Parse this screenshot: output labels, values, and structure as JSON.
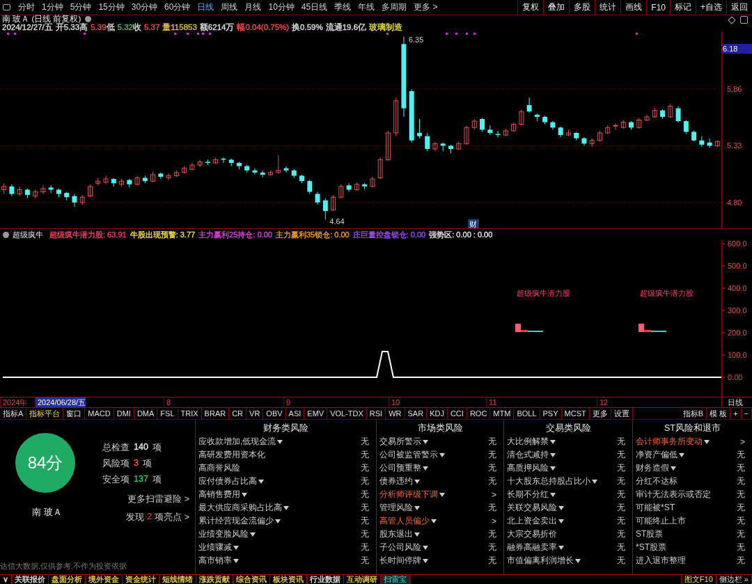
{
  "period_bar": {
    "items": [
      {
        "label": "分时",
        "selected": false
      },
      {
        "label": "1分钟",
        "selected": false
      },
      {
        "label": "5分钟",
        "selected": false
      },
      {
        "label": "15分钟",
        "selected": false
      },
      {
        "label": "30分钟",
        "selected": false
      },
      {
        "label": "60分钟",
        "selected": false
      },
      {
        "label": "日线",
        "selected": true
      },
      {
        "label": "周线",
        "selected": false
      },
      {
        "label": "月线",
        "selected": false
      },
      {
        "label": "10分钟",
        "selected": false
      },
      {
        "label": "45日线",
        "selected": false
      },
      {
        "label": "季线",
        "selected": false
      },
      {
        "label": "年线",
        "selected": false
      },
      {
        "label": "多周期",
        "selected": false
      },
      {
        "label": "更多 >",
        "selected": false
      }
    ],
    "buttons": [
      "复权",
      "叠加",
      "多股",
      "统计",
      "画线",
      "F10",
      "标记",
      "+自选",
      "返回"
    ]
  },
  "stock_header": {
    "title": "南 玻Ａ (日线 前复权)",
    "quote": [
      {
        "text": "2024/12/27/五",
        "color": "#e0e0e0"
      },
      {
        "text": "开5.33",
        "color": "#e0e0e0"
      },
      {
        "text": "高"
      },
      {
        "text": "5.39",
        "color": "#ff4a4a"
      },
      {
        "text": "低"
      },
      {
        "text": "5.32",
        "color": "#3ad13a"
      },
      {
        "text": "收"
      },
      {
        "text": "5.37",
        "color": "#ff4a4a"
      },
      {
        "text": "量115853",
        "color": "#e8c33a"
      },
      {
        "text": "额6214万",
        "color": "#e0e0e0"
      },
      {
        "text": "幅0.04(0.75%)",
        "color": "#ff4a4a"
      },
      {
        "text": "换0.59%",
        "color": "#e0e0e0"
      },
      {
        "text": "流通19.6亿",
        "color": "#e0e0e0"
      },
      {
        "text": "玻璃制造",
        "color": "#e8e03a"
      }
    ]
  },
  "price_chart": {
    "cursor_price": "6.18",
    "high_label": "6.35",
    "low_label": "4.64",
    "event_marker": "财",
    "chart_data": {
      "type": "candlestick",
      "grid": true,
      "ylim": [
        4.559,
        6.36
      ],
      "yticks": [
        {
          "value": 5.86,
          "label": "5.86"
        },
        {
          "value": 5.33,
          "label": "5.33"
        },
        {
          "value": 4.8,
          "label": "4.80"
        }
      ],
      "categories": [
        null,
        null,
        null,
        null,
        null,
        null,
        null,
        null,
        null,
        null,
        null,
        null,
        null,
        null,
        null,
        null,
        null,
        null,
        null,
        null,
        null,
        null,
        null,
        null,
        null,
        null,
        null,
        null,
        null,
        null,
        null,
        null,
        null,
        null,
        null,
        null,
        null,
        null,
        null,
        null,
        null,
        null,
        null,
        null,
        null,
        null,
        null,
        null,
        null,
        null,
        null,
        null,
        null,
        null,
        null,
        null,
        null,
        null,
        null,
        null,
        null,
        null,
        null,
        null,
        null,
        null,
        null,
        null,
        null,
        null,
        null,
        null,
        null,
        null,
        null,
        null,
        null,
        null,
        null,
        null,
        null,
        null,
        null,
        null,
        null,
        null,
        null,
        null,
        null,
        null,
        null,
        null
      ],
      "ohlc": [
        [
          4.92,
          4.98,
          4.88,
          4.95
        ],
        [
          4.95,
          4.97,
          4.86,
          4.88
        ],
        [
          4.88,
          4.95,
          4.86,
          4.92
        ],
        [
          4.92,
          4.93,
          4.84,
          4.87
        ],
        [
          4.86,
          4.92,
          4.84,
          4.9
        ],
        [
          4.9,
          4.96,
          4.88,
          4.93
        ],
        [
          4.94,
          4.96,
          4.89,
          4.92
        ],
        [
          4.92,
          4.93,
          4.85,
          4.88
        ],
        [
          4.89,
          4.9,
          4.82,
          4.85
        ],
        [
          4.86,
          4.88,
          4.76,
          4.8
        ],
        [
          4.8,
          4.87,
          4.78,
          4.85
        ],
        [
          4.86,
          4.97,
          4.85,
          4.95
        ],
        [
          4.98,
          5.03,
          4.96,
          5.0
        ],
        [
          4.99,
          5.05,
          4.97,
          5.02
        ],
        [
          5.02,
          5.03,
          4.95,
          4.98
        ],
        [
          4.97,
          5.02,
          4.95,
          5.0
        ],
        [
          5.01,
          5.02,
          4.94,
          4.97
        ],
        [
          4.97,
          5.05,
          4.96,
          5.03
        ],
        [
          5.03,
          5.05,
          4.98,
          5.0
        ],
        [
          5.0,
          5.09,
          4.99,
          5.06
        ],
        [
          5.07,
          5.08,
          5.02,
          5.04
        ],
        [
          5.03,
          5.07,
          5.01,
          5.05
        ],
        [
          5.05,
          5.1,
          5.04,
          5.08
        ],
        [
          5.08,
          5.14,
          5.07,
          5.12
        ],
        [
          5.11,
          5.17,
          5.1,
          5.15
        ],
        [
          5.15,
          5.2,
          5.13,
          5.18
        ],
        [
          5.18,
          5.2,
          5.15,
          5.17
        ],
        [
          5.17,
          5.22,
          5.16,
          5.2
        ],
        [
          5.21,
          5.22,
          5.17,
          5.2
        ],
        [
          5.2,
          5.21,
          5.14,
          5.17
        ],
        [
          5.17,
          5.18,
          5.11,
          5.14
        ],
        [
          5.14,
          5.15,
          5.08,
          5.1
        ],
        [
          5.1,
          5.12,
          5.06,
          5.08
        ],
        [
          5.08,
          5.1,
          5.04,
          5.06
        ],
        [
          5.06,
          5.1,
          5.05,
          5.08
        ],
        [
          5.08,
          5.24,
          5.07,
          5.1
        ],
        [
          5.12,
          5.14,
          5.08,
          5.1
        ],
        [
          5.1,
          5.11,
          5.03,
          5.05
        ],
        [
          5.05,
          5.06,
          4.98,
          5.0
        ],
        [
          5.0,
          5.01,
          4.88,
          4.9
        ],
        [
          4.88,
          4.9,
          4.78,
          4.8
        ],
        [
          4.82,
          4.84,
          4.64,
          4.72
        ],
        [
          4.73,
          4.87,
          4.72,
          4.85
        ],
        [
          4.85,
          4.97,
          4.84,
          4.95
        ],
        [
          4.96,
          4.98,
          4.9,
          4.92
        ],
        [
          4.92,
          4.99,
          4.91,
          4.97
        ],
        [
          4.97,
          4.98,
          4.92,
          4.95
        ],
        [
          4.95,
          5.04,
          4.94,
          5.02
        ],
        [
          5.03,
          5.22,
          5.02,
          5.2
        ],
        [
          5.2,
          5.47,
          5.19,
          5.45
        ],
        [
          5.45,
          5.78,
          5.42,
          5.75
        ],
        [
          6.28,
          6.35,
          5.6,
          5.68
        ],
        [
          5.84,
          5.86,
          5.36,
          5.38
        ],
        [
          5.45,
          5.58,
          5.4,
          5.42
        ],
        [
          5.42,
          5.45,
          5.28,
          5.3
        ],
        [
          5.3,
          5.37,
          5.28,
          5.35
        ],
        [
          5.35,
          5.36,
          5.28,
          5.33
        ],
        [
          5.33,
          5.34,
          5.26,
          5.3
        ],
        [
          5.3,
          5.37,
          5.29,
          5.35
        ],
        [
          5.35,
          5.52,
          5.34,
          5.5
        ],
        [
          5.5,
          5.58,
          5.48,
          5.56
        ],
        [
          5.58,
          5.59,
          5.46,
          5.48
        ],
        [
          5.48,
          5.52,
          5.43,
          5.45
        ],
        [
          5.44,
          5.47,
          5.41,
          5.43
        ],
        [
          5.43,
          5.49,
          5.42,
          5.47
        ],
        [
          5.47,
          5.55,
          5.46,
          5.53
        ],
        [
          5.53,
          5.67,
          5.52,
          5.65
        ],
        [
          5.71,
          5.78,
          5.64,
          5.65
        ],
        [
          5.62,
          5.63,
          5.56,
          5.6
        ],
        [
          5.6,
          5.61,
          5.53,
          5.55
        ],
        [
          5.55,
          5.56,
          5.48,
          5.5
        ],
        [
          5.5,
          5.51,
          5.41,
          5.43
        ],
        [
          5.43,
          5.48,
          5.42,
          5.45
        ],
        [
          5.45,
          5.46,
          5.38,
          5.4
        ],
        [
          5.4,
          5.41,
          5.33,
          5.35
        ],
        [
          5.35,
          5.4,
          5.32,
          5.38
        ],
        [
          5.38,
          5.47,
          5.37,
          5.45
        ],
        [
          5.45,
          5.52,
          5.44,
          5.5
        ],
        [
          5.52,
          5.54,
          5.48,
          5.52
        ],
        [
          5.5,
          5.57,
          5.49,
          5.55
        ],
        [
          5.55,
          5.56,
          5.48,
          5.5
        ],
        [
          5.5,
          5.59,
          5.49,
          5.57
        ],
        [
          5.57,
          5.62,
          5.56,
          5.6
        ],
        [
          5.6,
          5.68,
          5.59,
          5.66
        ],
        [
          5.66,
          5.67,
          5.58,
          5.6
        ],
        [
          5.6,
          5.72,
          5.59,
          5.7
        ],
        [
          5.68,
          5.7,
          5.55,
          5.56
        ],
        [
          5.56,
          5.57,
          5.44,
          5.46
        ],
        [
          5.46,
          5.47,
          5.37,
          5.38
        ],
        [
          5.38,
          5.42,
          5.32,
          5.34
        ],
        [
          5.36,
          5.4,
          5.31,
          5.33
        ],
        [
          5.33,
          5.38,
          5.32,
          5.37
        ]
      ]
    }
  },
  "indicator": {
    "name": "超级疯牛",
    "values": [
      {
        "text": "超级疯牛潜力股: 63.91",
        "color": "#ff3a6a"
      },
      {
        "text": "牛股出现预警: 3.77",
        "color": "#f0e040"
      },
      {
        "text": "主力赢利25持仓: 0.00",
        "color": "#e040e0"
      },
      {
        "text": "主力赢利35锁仓: 0.00",
        "color": "#f0a020"
      },
      {
        "text": "庄巨量控盘锁仓: 0.00",
        "color": "#9a50ff"
      },
      {
        "text": "强势区: 0.00 : 0.00",
        "color": "#e8e8e8"
      }
    ],
    "signal_labels": [
      "超级疯牛潜力股",
      "超级疯牛潜力股"
    ],
    "axis_labels": [
      "600.0",
      "500.0",
      "400.0",
      "300.0",
      "200.0",
      "100.0",
      "0.00"
    ]
  },
  "timeline": {
    "labels": [
      {
        "text": "2024年",
        "selected": false
      },
      {
        "text": "2024/06/28/五",
        "selected": true
      },
      {
        "text": "8",
        "selected": false
      },
      {
        "text": "9",
        "selected": false
      },
      {
        "text": "10",
        "selected": false
      },
      {
        "text": "11",
        "selected": false
      },
      {
        "text": "12",
        "selected": false
      }
    ],
    "period": "日线"
  },
  "indicator_tabs": {
    "items": [
      {
        "label": "指标A",
        "selected": false
      },
      {
        "label": "指标平台",
        "selected": true
      },
      {
        "label": "窗口",
        "selected": false
      },
      {
        "label": "MACD",
        "selected": false
      },
      {
        "label": "DMI",
        "selected": false
      },
      {
        "label": "DMA",
        "selected": false
      },
      {
        "label": "FSL",
        "selected": false
      },
      {
        "label": "TRIX",
        "selected": false
      },
      {
        "label": "BRAR",
        "selected": false
      },
      {
        "label": "CR",
        "selected": false
      },
      {
        "label": "VR",
        "selected": false
      },
      {
        "label": "OBV",
        "selected": false
      },
      {
        "label": "ASI",
        "selected": false
      },
      {
        "label": "EMV",
        "selected": false
      },
      {
        "label": "VOL-TDX",
        "selected": false
      },
      {
        "label": "RSI",
        "selected": false
      },
      {
        "label": "WR",
        "selected": false
      },
      {
        "label": "SAR",
        "selected": false
      },
      {
        "label": "KDJ",
        "selected": false
      },
      {
        "label": "CCI",
        "selected": false
      },
      {
        "label": "ROC",
        "selected": false
      },
      {
        "label": "MTM",
        "selected": false
      },
      {
        "label": "BOLL",
        "selected": false
      },
      {
        "label": "PSY",
        "selected": false
      },
      {
        "label": "MCST",
        "selected": false
      },
      {
        "label": "更多",
        "selected": false
      },
      {
        "label": "设置",
        "selected": false
      }
    ],
    "right": [
      "指标B",
      "模 板",
      "+",
      "−"
    ]
  },
  "risk_scan": {
    "score": "84分",
    "stock": "南 玻Ａ",
    "stats": [
      {
        "label": "总检查",
        "value": "140",
        "unit": "项",
        "color": "#e8e8e8"
      },
      {
        "label": "风险项",
        "value": "3",
        "unit": "项",
        "color": "#f06030"
      },
      {
        "label": "安全项",
        "value": "137",
        "unit": "项",
        "color": "#2ec070"
      }
    ],
    "more_link": "更多扫雷避险 >",
    "highlights": {
      "prefix": "发现",
      "count": "2",
      "suffix": "项亮点 >"
    },
    "disclaimer": "达信大数据,仅供参考,不作为投资依据",
    "columns": [
      {
        "title": "财务类风险",
        "rows": [
          {
            "label": "应收款增加,低现金流",
            "dropdown": true,
            "highlighted": false,
            "result": "无"
          },
          {
            "label": "高研发费用资本化",
            "dropdown": false,
            "highlighted": false,
            "result": "无"
          },
          {
            "label": "高商誉风险",
            "dropdown": false,
            "highlighted": false,
            "result": "无"
          },
          {
            "label": "应付债券占比高",
            "dropdown": true,
            "highlighted": false,
            "result": "无"
          },
          {
            "label": "高销售费用",
            "dropdown": true,
            "highlighted": false,
            "result": "无"
          },
          {
            "label": "最大供应商采购占比高",
            "dropdown": true,
            "highlighted": false,
            "result": "无"
          },
          {
            "label": "累计经营现金流偏少",
            "dropdown": true,
            "highlighted": false,
            "result": "无"
          },
          {
            "label": "业绩变脸风险",
            "dropdown": true,
            "highlighted": false,
            "result": "无"
          },
          {
            "label": "业绩骤减",
            "dropdown": true,
            "highlighted": false,
            "result": "无"
          },
          {
            "label": "高市销率",
            "dropdown": true,
            "highlighted": false,
            "result": "无"
          }
        ]
      },
      {
        "title": "市场类风险",
        "rows": [
          {
            "label": "交易所警示",
            "dropdown": true,
            "highlighted": false,
            "result": "无"
          },
          {
            "label": "公司被监管警示",
            "dropdown": true,
            "highlighted": false,
            "result": "无"
          },
          {
            "label": "公司预重整",
            "dropdown": true,
            "highlighted": false,
            "result": "无"
          },
          {
            "label": "债券违约",
            "dropdown": true,
            "highlighted": false,
            "result": "无"
          },
          {
            "label": "分析师评级下调",
            "dropdown": true,
            "highlighted": true,
            "result": ">"
          },
          {
            "label": "管理风险",
            "dropdown": true,
            "highlighted": false,
            "result": "无"
          },
          {
            "label": "高管人员偏少",
            "dropdown": true,
            "highlighted": true,
            "result": ">"
          },
          {
            "label": "股东退出",
            "dropdown": true,
            "highlighted": false,
            "result": "无"
          },
          {
            "label": "子公司风险",
            "dropdown": true,
            "highlighted": false,
            "result": "无"
          },
          {
            "label": "长时间停牌",
            "dropdown": true,
            "highlighted": false,
            "result": "无"
          }
        ]
      },
      {
        "title": "交易类风险",
        "rows": [
          {
            "label": "大比例解禁",
            "dropdown": true,
            "highlighted": false,
            "result": "无"
          },
          {
            "label": "清仓式减持",
            "dropdown": true,
            "highlighted": false,
            "result": "无"
          },
          {
            "label": "高质押风险",
            "dropdown": true,
            "highlighted": false,
            "result": "无"
          },
          {
            "label": "十大股东总持股占比小",
            "dropdown": true,
            "highlighted": false,
            "result": "无"
          },
          {
            "label": "长期不分红",
            "dropdown": true,
            "highlighted": false,
            "result": "无"
          },
          {
            "label": "关联交易风险",
            "dropdown": true,
            "highlighted": false,
            "result": "无"
          },
          {
            "label": "北上资金卖出",
            "dropdown": true,
            "highlighted": false,
            "result": "无"
          },
          {
            "label": "大宗交易折价",
            "dropdown": false,
            "highlighted": false,
            "result": "无"
          },
          {
            "label": "融券高融卖率",
            "dropdown": true,
            "highlighted": false,
            "result": "无"
          },
          {
            "label": "市值偏离利润增长",
            "dropdown": true,
            "highlighted": false,
            "result": "无"
          }
        ]
      },
      {
        "title": "ST风险和退市",
        "rows": [
          {
            "label": "会计师事务所变动",
            "dropdown": true,
            "highlighted": true,
            "result": ">"
          },
          {
            "label": "净资产偏低",
            "dropdown": true,
            "highlighted": false,
            "result": "无"
          },
          {
            "label": "财务造假",
            "dropdown": true,
            "highlighted": false,
            "result": "无"
          },
          {
            "label": "分红不达标",
            "dropdown": false,
            "highlighted": false,
            "result": "无"
          },
          {
            "label": "审计无法表示或否定",
            "dropdown": false,
            "highlighted": false,
            "result": "无"
          },
          {
            "label": "可能被*ST",
            "dropdown": false,
            "highlighted": false,
            "result": "无"
          },
          {
            "label": "可能终止上市",
            "dropdown": false,
            "highlighted": false,
            "result": "无"
          },
          {
            "label": "ST股票",
            "dropdown": false,
            "highlighted": false,
            "result": "无"
          },
          {
            "label": "*ST股票",
            "dropdown": false,
            "highlighted": false,
            "result": "无"
          },
          {
            "label": "进入退市整理",
            "dropdown": false,
            "highlighted": false,
            "result": "无"
          }
        ]
      }
    ]
  },
  "bottom_tabs": {
    "items": [
      {
        "label": "∨",
        "color": "#e0e0e0",
        "selected": false
      },
      {
        "label": "关联报价",
        "color": "#e0e0e0",
        "selected": false
      },
      {
        "label": "盘面分析",
        "color": "#e8d040",
        "selected": false
      },
      {
        "label": "境外资金",
        "color": "#e8d040",
        "selected": false
      },
      {
        "label": "资金统计",
        "color": "#e8d040",
        "selected": false
      },
      {
        "label": "短线情绪",
        "color": "#e8d040",
        "selected": false
      },
      {
        "label": "涨跌贡献",
        "color": "#e8d040",
        "selected": false
      },
      {
        "label": "综合资讯",
        "color": "#e8d040",
        "selected": false
      },
      {
        "label": "板块资讯",
        "color": "#e8d040",
        "selected": false
      },
      {
        "label": "行业数据",
        "color": "#e0e0e0",
        "selected": false
      },
      {
        "label": "互动调研",
        "color": "#e8d040",
        "selected": false
      },
      {
        "label": "扫雷宝",
        "selected": true
      }
    ],
    "right": [
      "图文F10",
      "侧边栏 »"
    ]
  }
}
